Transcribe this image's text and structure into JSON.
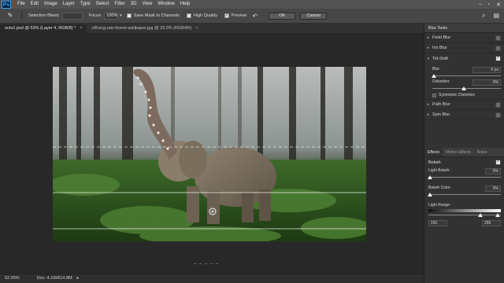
{
  "menubar": {
    "logo": "Ps",
    "items": [
      "File",
      "Edit",
      "Image",
      "Layer",
      "Type",
      "Select",
      "Filter",
      "3D",
      "View",
      "Window",
      "Help"
    ]
  },
  "optionbar": {
    "selection_bleed_label": "Selection Bleed:",
    "focus_label": "Focus:",
    "focus_value": "100%",
    "save_mask_label": "Save Mask to Channels",
    "high_quality_label": "High Quality",
    "preview_label": "Preview",
    "ok_label": "OK",
    "cancel_label": "Cancel"
  },
  "tabs": [
    {
      "label": "octo1.psd @ 53% (Layer 4, RGB/8) *",
      "active": true
    },
    {
      "label": "v9hscg-rain-forest-wallpaper.jpg @ 33.3% (RGB/8#)",
      "active": false
    }
  ],
  "status": {
    "zoom": "52.99%",
    "doc": "Doc: 4.10M/14.8M"
  },
  "canvas": {
    "page_dots": "– – – – –"
  },
  "blur_tools": {
    "header": "Blur Tools",
    "items": [
      {
        "label": "Field Blur",
        "checked": false
      },
      {
        "label": "Iris Blur",
        "checked": false
      },
      {
        "label": "Tilt-Shift",
        "checked": true
      },
      {
        "label": "Path Blur",
        "checked": false
      },
      {
        "label": "Spin Blur",
        "checked": false
      }
    ],
    "tilt_shift": {
      "blur_label": "Blur:",
      "blur_value": "0 px",
      "distortion_label": "Distortion:",
      "distortion_value": "0%",
      "symmetric_label": "Symmetric Distortion"
    }
  },
  "effects": {
    "tabs": [
      "Effects",
      "Motion Effects",
      "Noise"
    ],
    "bokeh_label": "Bokeh",
    "light_bokeh_label": "Light Bokeh:",
    "light_bokeh_value": "0%",
    "bokeh_color_label": "Bokeh Color:",
    "bokeh_color_value": "0%",
    "light_range_label": "Light Range:",
    "light_range_low": "191",
    "light_range_high": "255"
  }
}
